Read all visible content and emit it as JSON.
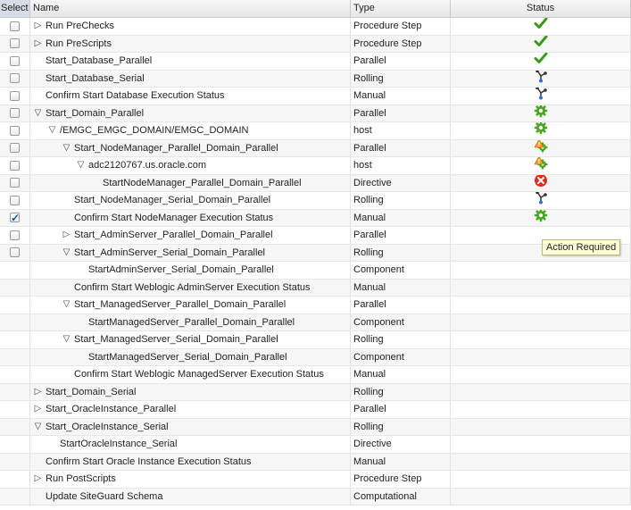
{
  "columns": {
    "select": "Select",
    "name": "Name",
    "type": "Type",
    "status": "Status"
  },
  "rows": [
    {
      "name": "Run PreChecks",
      "type": "Procedure Step",
      "depth": 0,
      "disc": "collapsed",
      "checked": false,
      "status": "check-icon"
    },
    {
      "name": "Run PreScripts",
      "type": "Procedure Step",
      "depth": 0,
      "disc": "collapsed",
      "checked": false,
      "status": "check-icon"
    },
    {
      "name": "Start_Database_Parallel",
      "type": "Parallel",
      "depth": 0,
      "disc": "none",
      "checked": false,
      "status": "check-icon"
    },
    {
      "name": "Start_Database_Serial",
      "type": "Rolling",
      "depth": 0,
      "disc": "none",
      "checked": false,
      "status": "branch-icon"
    },
    {
      "name": "Confirm Start Database Execution Status",
      "type": "Manual",
      "depth": 0,
      "disc": "none",
      "checked": false,
      "status": "branch-icon"
    },
    {
      "name": "Start_Domain_Parallel",
      "type": "Parallel",
      "depth": 0,
      "disc": "expanded",
      "checked": false,
      "status": "gear-icon"
    },
    {
      "name": "/EMGC_EMGC_DOMAIN/EMGC_DOMAIN",
      "type": "host",
      "depth": 1,
      "disc": "expanded",
      "checked": false,
      "status": "gear-icon"
    },
    {
      "name": "Start_NodeManager_Parallel_Domain_Parallel",
      "type": "Parallel",
      "depth": 2,
      "disc": "expanded",
      "checked": false,
      "status": "warning-gear-icon"
    },
    {
      "name": "adc2120767.us.oracle.com",
      "type": "host",
      "depth": 3,
      "disc": "expanded",
      "checked": false,
      "status": "warning-gear-icon"
    },
    {
      "name": "StartNodeManager_Parallel_Domain_Parallel",
      "type": "Directive",
      "depth": 4,
      "disc": "none",
      "checked": false,
      "status": "error-icon"
    },
    {
      "name": "Start_NodeManager_Serial_Domain_Parallel",
      "type": "Rolling",
      "depth": 2,
      "disc": "none",
      "checked": false,
      "status": "branch-icon"
    },
    {
      "name": "Confirm Start NodeManager Execution Status",
      "type": "Manual",
      "depth": 2,
      "disc": "none",
      "checked": true,
      "status": "gear-icon"
    },
    {
      "name": "Start_AdminServer_Parallel_Domain_Parallel",
      "type": "Parallel",
      "depth": 2,
      "disc": "collapsed",
      "checked": false,
      "status": ""
    },
    {
      "name": "Start_AdminServer_Serial_Domain_Parallel",
      "type": "Rolling",
      "depth": 2,
      "disc": "expanded",
      "checked": false,
      "status": ""
    },
    {
      "name": "StartAdminServer_Serial_Domain_Parallel",
      "type": "Component",
      "depth": 3,
      "disc": "none",
      "checked": null,
      "status": ""
    },
    {
      "name": "Confirm Start Weblogic AdminServer Execution Status",
      "type": "Manual",
      "depth": 2,
      "disc": "none",
      "checked": null,
      "status": ""
    },
    {
      "name": "Start_ManagedServer_Parallel_Domain_Parallel",
      "type": "Parallel",
      "depth": 2,
      "disc": "expanded",
      "checked": null,
      "status": ""
    },
    {
      "name": "StartManagedServer_Parallel_Domain_Parallel",
      "type": "Component",
      "depth": 3,
      "disc": "none",
      "checked": null,
      "status": ""
    },
    {
      "name": "Start_ManagedServer_Serial_Domain_Parallel",
      "type": "Rolling",
      "depth": 2,
      "disc": "expanded",
      "checked": null,
      "status": ""
    },
    {
      "name": "StartManagedServer_Serial_Domain_Parallel",
      "type": "Component",
      "depth": 3,
      "disc": "none",
      "checked": null,
      "status": ""
    },
    {
      "name": "Confirm Start Weblogic ManagedServer Execution Status",
      "type": "Manual",
      "depth": 2,
      "disc": "none",
      "checked": null,
      "status": ""
    },
    {
      "name": "Start_Domain_Serial",
      "type": "Rolling",
      "depth": 0,
      "disc": "collapsed",
      "checked": null,
      "status": ""
    },
    {
      "name": "Start_OracleInstance_Parallel",
      "type": "Parallel",
      "depth": 0,
      "disc": "collapsed",
      "checked": null,
      "status": ""
    },
    {
      "name": "Start_OracleInstance_Serial",
      "type": "Rolling",
      "depth": 0,
      "disc": "expanded",
      "checked": null,
      "status": ""
    },
    {
      "name": "StartOracleInstance_Serial",
      "type": "Directive",
      "depth": 1,
      "disc": "none",
      "checked": null,
      "status": ""
    },
    {
      "name": "Confirm Start Oracle Instance Execution Status",
      "type": "Manual",
      "depth": 0,
      "disc": "none",
      "checked": null,
      "status": ""
    },
    {
      "name": "Run PostScripts",
      "type": "Procedure Step",
      "depth": 0,
      "disc": "collapsed",
      "checked": null,
      "status": ""
    },
    {
      "name": "Update SiteGuard Schema",
      "type": "Computational",
      "depth": 0,
      "disc": "none",
      "checked": null,
      "status": ""
    }
  ],
  "tooltip": "Action Required",
  "colors": {
    "check": "#3a9a1f",
    "gear": "#48a51f",
    "warning": "#e8a21a",
    "error": "#d8301e",
    "branch": "#3070c8"
  }
}
